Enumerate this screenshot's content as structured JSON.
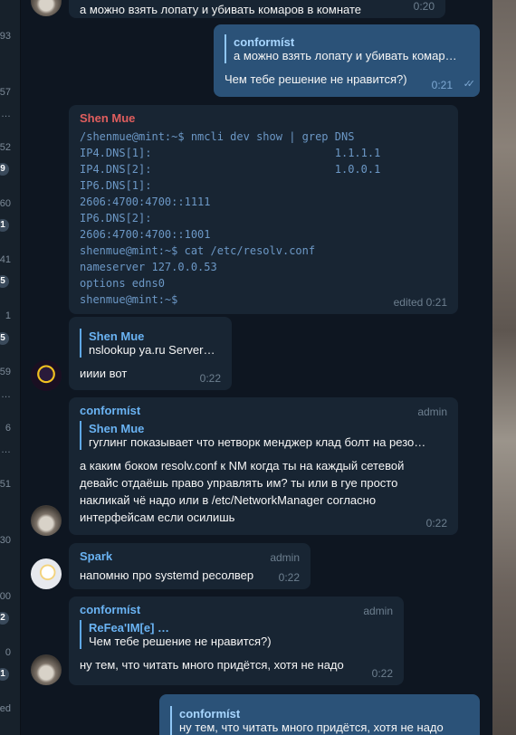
{
  "left_strip": {
    "numbers": [
      "93",
      "57",
      "…",
      "52",
      "60",
      "41",
      "1",
      "59",
      "…",
      "6",
      "…",
      "51",
      "30",
      "00",
      "0",
      "ed"
    ],
    "badges": [
      "9",
      "1",
      "5",
      "5",
      "2",
      "1"
    ]
  },
  "messages": {
    "m1": {
      "text": "а можно взять лопату и убивать комаров в комнате",
      "time": "0:20"
    },
    "m2": {
      "reply_name": "conformíst",
      "reply_text": "а можно взять лопату и убивать комар…",
      "text": "Чем тебе решение не нравится?)",
      "time": "0:21",
      "status_icon": "double-check-icon"
    },
    "m3": {
      "sender": "Shen Mue",
      "sender_color": "#e05e5e",
      "code_lines": [
        "/shenmue@mint:~$ nmcli dev show | grep DNS",
        "IP4.DNS[1]:                            1.1.1.1",
        "IP4.DNS[2]:                            1.0.0.1",
        "IP6.DNS[1]:",
        "2606:4700:4700::1111",
        "IP6.DNS[2]:",
        "2606:4700:4700::1001",
        "shenmue@mint:~$ cat /etc/resolv.conf",
        "nameserver 127.0.0.53",
        "options edns0",
        "shenmue@mint:~$"
      ],
      "time": "edited 0:21"
    },
    "m4": {
      "reply_name": "Shen Mue",
      "reply_text": "nslookup ya.ru Server…",
      "text": "ииии вот",
      "time": "0:22"
    },
    "m5": {
      "sender": "conformíst",
      "sender_color": "#6ab3f3",
      "role": "admin",
      "reply_name": "Shen Mue",
      "reply_text": "гуглинг показывает что нетворк менджер клад болт на резо…",
      "text": "а каким боком resolv.conf к NM когда ты на каждый сетевой девайс отдаёшь право управлять им? ты или в гуе просто накликай чё надо или в /etc/NetworkManager согласно интерфейсам если осилишь",
      "time": "0:22"
    },
    "m6": {
      "sender": "Spark",
      "sender_color": "#6ab3f3",
      "role": "admin",
      "text": "напомню про systemd ресолвер",
      "time": "0:22"
    },
    "m7": {
      "sender": "conformíst",
      "sender_color": "#6ab3f3",
      "role": "admin",
      "reply_name": "ReFea'IM[e] …",
      "reply_text": "Чем тебе решение не нравится?)",
      "text": "ну тем, что читать много придётся, хотя не надо",
      "time": "0:22"
    },
    "m8": {
      "reply_name": "conformíst",
      "reply_text": "ну тем, что читать много придётся, хотя не надо"
    }
  }
}
